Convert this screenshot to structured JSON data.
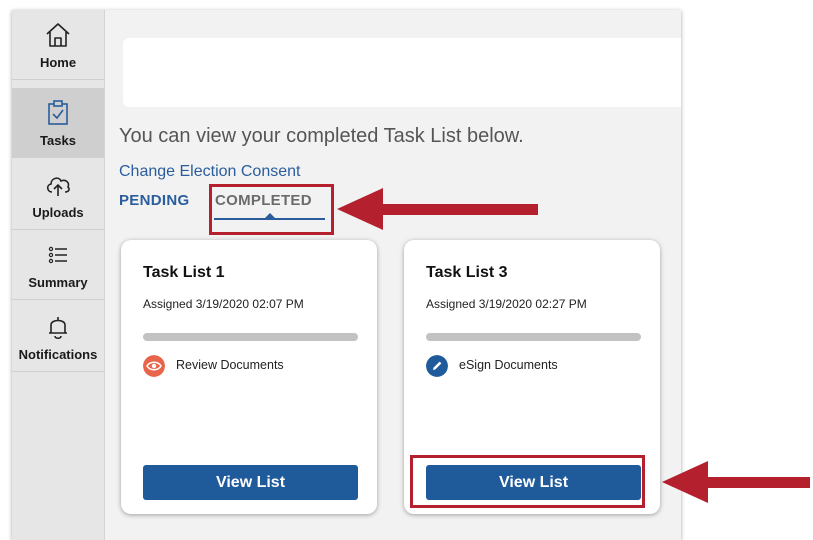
{
  "sidebar": {
    "items": [
      {
        "label": "Home",
        "icon": "home-icon"
      },
      {
        "label": "Tasks",
        "icon": "clipboard-check-icon",
        "active": true
      },
      {
        "label": "Uploads",
        "icon": "cloud-upload-icon"
      },
      {
        "label": "Summary",
        "icon": "list-icon"
      },
      {
        "label": "Notifications",
        "icon": "bell-icon"
      }
    ]
  },
  "main": {
    "intro": "You can view your completed Task List below.",
    "consent_link": "Change Election Consent",
    "tabs": [
      {
        "label": "PENDING"
      },
      {
        "label": "COMPLETED",
        "active": true
      }
    ]
  },
  "cards": [
    {
      "title": "Task List 1",
      "assigned": "Assigned 3/19/2020 02:07 PM",
      "progress": 1.0,
      "action_label": "Review Documents",
      "action_icon": "eye-icon",
      "action_color": "#e8644a",
      "button_label": "View List"
    },
    {
      "title": "Task List 3",
      "assigned": "Assigned 3/19/2020 02:27 PM",
      "progress": 1.0,
      "action_label": "eSign Documents",
      "action_icon": "pencil-icon",
      "action_color": "#1f5a9b",
      "button_label": "View List"
    }
  ],
  "colors": {
    "accent": "#2a5d9c",
    "button": "#1f5a9b",
    "highlight": "#b5202e"
  }
}
